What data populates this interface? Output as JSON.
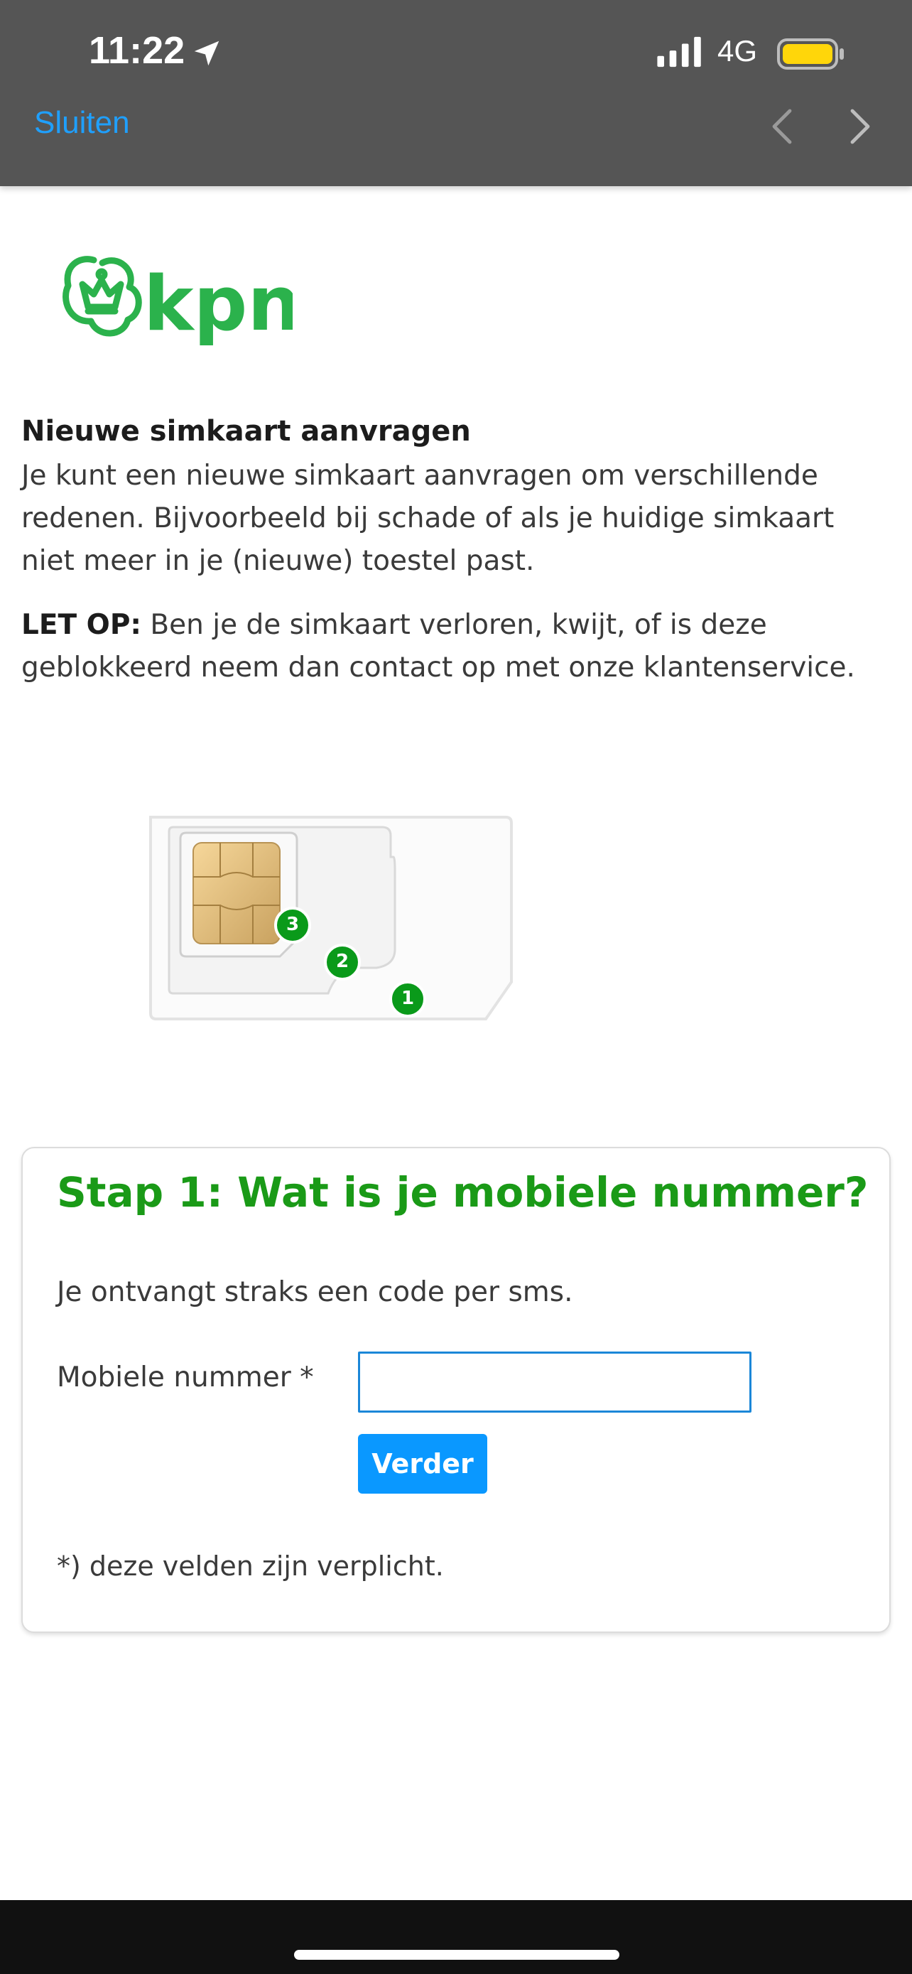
{
  "status_bar": {
    "time": "11:22",
    "network": "4G",
    "icons": [
      "location-arrow-icon",
      "cellular-signal-icon",
      "battery-icon"
    ],
    "battery_color": "#ffd60a"
  },
  "nav": {
    "close_label": "Sluiten",
    "back_icon": "chevron-left-icon",
    "forward_icon": "chevron-right-icon"
  },
  "brand": {
    "name": "kpn",
    "color": "#2bb24c"
  },
  "intro": {
    "title": "Nieuwe simkaart aanvragen",
    "body": "Je kunt een nieuwe simkaart aanvragen om verschillende redenen. Bijvoorbeeld bij schade of als je huidige simkaart niet meer in je (nieuwe) toestel past.",
    "warning_label": "LET OP:",
    "warning_text": " Ben je de simkaart verloren, kwijt, of is deze geblokkeerd neem dan contact op met onze klantenservice."
  },
  "sim_image": {
    "labels": [
      "1",
      "2",
      "3"
    ],
    "badge_color": "#0a9a1a"
  },
  "step": {
    "title": "Stap 1: Wat is je mobiele nummer?",
    "note": "Je ontvangt straks een code per sms.",
    "field_label": "Mobiele nummer *",
    "field_value": "",
    "button_label": "Verder",
    "required_note": "*) deze velden zijn verplicht.",
    "title_color": "#1a9a17",
    "button_color": "#0a98ff"
  }
}
